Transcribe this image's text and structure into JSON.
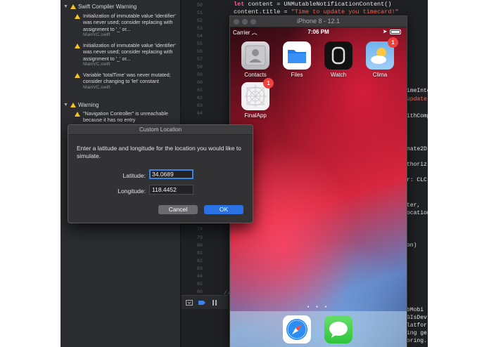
{
  "navigator": {
    "sections": [
      {
        "title": "Swift Compiler Warning"
      },
      {
        "title": "Warning"
      }
    ],
    "issues": [
      {
        "message": "Initialization of immutable value 'identifier' was never used; consider replacing with assignment to '_' or...",
        "file": "MainVC.swift"
      },
      {
        "message": "Initialization of immutable value 'identifier' was never used; consider replacing with assignment to '_' or...",
        "file": "MainVC.swift"
      },
      {
        "message": "Variable 'totalTime' was never mutated; consider changing to 'let' constant",
        "file": "MainVC.swift"
      },
      {
        "message": "\"Navigation Controller\" is unreachable because it has no entry",
        "file": ""
      }
    ]
  },
  "editor": {
    "line_numbers_top": [
      "50",
      "51",
      "52",
      "53",
      "54",
      "55",
      "56",
      "57",
      "58",
      "59",
      "60",
      "61",
      "62",
      "63",
      "64",
      "65",
      "66",
      "67"
    ],
    "line_numbers_bottom": [
      "78",
      "79",
      "80",
      "81",
      "82",
      "83",
      "84",
      "85",
      "86"
    ],
    "code_line_1": {
      "kw": "let",
      "rest": " content = UNMutableNotificationContent()"
    },
    "code_line_2": {
      "plain": "content.title = ",
      "string": "\"Time to update you timecard!\""
    },
    "right_fragments": [
      "imeInte",
      "update",
      "ithComp",
      "nate2D",
      "thoriz",
      "r: CLC",
      "ter,",
      "ocation",
      "on)",
      "bMobi",
      "GIsDev",
      "latfor",
      "ing ge",
      "oring."
    ],
    "brace_1": "}",
    "brace_2": "}",
    "comment": "//"
  },
  "simulator": {
    "title": "iPhone 8 - 12.1",
    "carrier": "Carrier",
    "time": "7:06 PM",
    "apps": [
      {
        "label": "Contacts",
        "badge": ""
      },
      {
        "label": "Files",
        "badge": ""
      },
      {
        "label": "Watch",
        "badge": ""
      },
      {
        "label": "Clima",
        "badge": "1"
      },
      {
        "label": "FinalApp",
        "badge": "1"
      }
    ],
    "dock_apps": [
      "safari-icon",
      "messages-icon"
    ],
    "page_dots": "• • •"
  },
  "dialog": {
    "title": "Custom Location",
    "message": "Enter a latitude and longitude for the location you would like to simulate.",
    "latitude_label": "Latitude:",
    "latitude_value": "34.0689",
    "longitude_label": "Longitude:",
    "longitude_value": "118.4452",
    "cancel_label": "Cancel",
    "ok_label": "OK"
  },
  "colors": {
    "warning": "#f5c324",
    "accent": "#2a72e2",
    "badge": "#f0403c"
  }
}
